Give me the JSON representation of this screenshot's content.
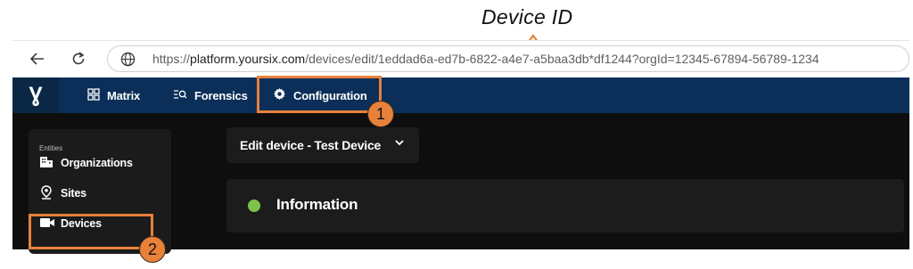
{
  "annotation": {
    "title": "Device ID",
    "badge_1": "1",
    "badge_2": "2",
    "accent": "#e8813a"
  },
  "browser": {
    "back_icon": "arrow-left-icon",
    "reload_icon": "reload-icon",
    "site_icon": "globe-icon",
    "url_prefix": "https://",
    "url_host": "platform.yoursix.com",
    "url_path": "/devices/edit/1eddad6a-ed7b-6822-a4e7-a5baa3db*df1244?orgId=12345-67894-56789-1234"
  },
  "header": {
    "bg": "#0b2f58",
    "logo": "Ɣ",
    "nav": [
      {
        "label": "Matrix",
        "icon": "grid-icon"
      },
      {
        "label": "Forensics",
        "icon": "search-list-icon"
      },
      {
        "label": "Configuration",
        "icon": "gear-icon"
      }
    ]
  },
  "sidebar": {
    "section_label": "Entities",
    "items": [
      {
        "label": "Organizations",
        "icon": "building-icon"
      },
      {
        "label": "Sites",
        "icon": "location-pin-icon"
      },
      {
        "label": "Devices",
        "icon": "video-camera-icon"
      }
    ]
  },
  "main": {
    "device_selector": "Edit device - Test Device",
    "info_panel_title": "Information",
    "status_color": "#7ec24a"
  }
}
